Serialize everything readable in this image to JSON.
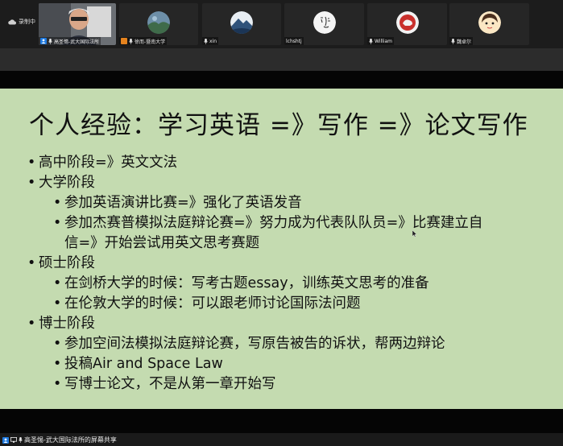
{
  "recording": {
    "label": "录制中"
  },
  "participants": [
    {
      "name": "高圣惕-武大国际法所",
      "kind": "video"
    },
    {
      "name": "徐而-暨南大学",
      "kind": "landscape",
      "color": "#4a7a5a"
    },
    {
      "name": "xin",
      "kind": "mountain",
      "color": "#3a5f8a"
    },
    {
      "name": "lchshtj",
      "kind": "calligraphy",
      "color": "#f2f2f2"
    },
    {
      "name": "William",
      "kind": "emblem",
      "color": "#c9302c"
    },
    {
      "name": "魏卓尔",
      "kind": "cartoon",
      "color": "#f5d6a0"
    }
  ],
  "slide": {
    "title": "个人经验：学习英语 =》写作 =》论文写作",
    "lines": [
      {
        "level": 1,
        "text": "高中阶段=》英文文法"
      },
      {
        "level": 1,
        "text": "大学阶段"
      },
      {
        "level": 2,
        "text": "参加英语演讲比赛=》强化了英语发音"
      },
      {
        "level": 2,
        "text": "参加杰赛普模拟法庭辩论赛=》努力成为代表队队员=》比赛建立自"
      },
      {
        "level": 3,
        "text": "信=》开始尝试用英文思考赛题"
      },
      {
        "level": 1,
        "text": "硕士阶段"
      },
      {
        "level": 2,
        "text": "在剑桥大学的时候：写考古题essay，训练英文思考的准备"
      },
      {
        "level": 2,
        "text": "在伦敦大学的时候：可以跟老师讨论国际法问题"
      },
      {
        "level": 1,
        "text": "博士阶段"
      },
      {
        "level": 2,
        "text": "参加空间法模拟法庭辩论赛，写原告被告的诉状，帮两边辩论"
      },
      {
        "level": 2,
        "text": "投稿Air and Space Law"
      },
      {
        "level": 2,
        "text": "写博士论文，不是从第一章开始写"
      }
    ]
  },
  "share": {
    "label": "高圣惕-武大国际法所的屏幕共享"
  }
}
